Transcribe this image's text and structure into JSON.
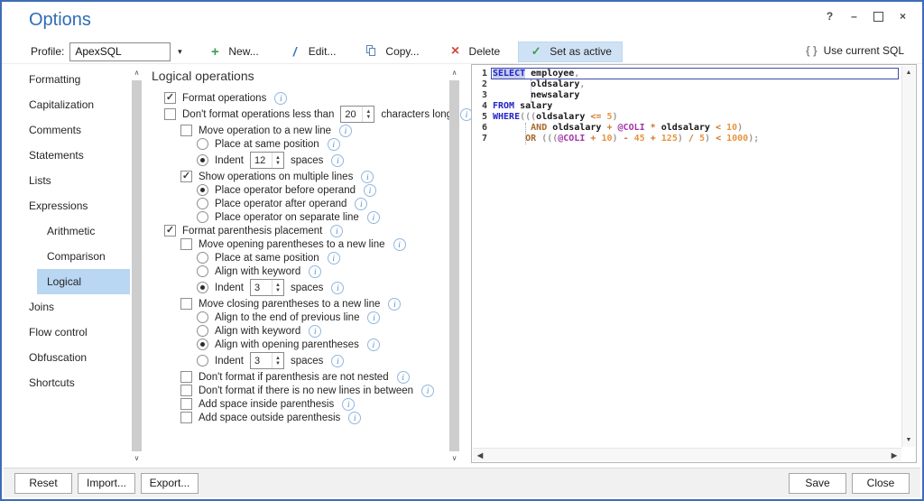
{
  "window": {
    "title": "Options",
    "controls": [
      {
        "name": "help-button",
        "glyph": "?"
      },
      {
        "name": "minimize-button",
        "glyph": "–"
      },
      {
        "name": "maximize-button",
        "glyph": ""
      },
      {
        "name": "close-button",
        "glyph": "×"
      }
    ]
  },
  "toolbar": {
    "profile_label": "Profile:",
    "profile_value": "ApexSQL",
    "dropdown_glyph": "▾",
    "buttons": [
      {
        "name": "new-button",
        "label": "New...",
        "icon": "plus-icon",
        "glyph": "+",
        "active": false
      },
      {
        "name": "edit-button",
        "label": "Edit...",
        "icon": "pencil-icon",
        "glyph": "/",
        "active": false
      },
      {
        "name": "copy-button",
        "label": "Copy...",
        "icon": "copy-icon",
        "glyph": "",
        "active": false
      },
      {
        "name": "delete-button",
        "label": "Delete",
        "icon": "delete-x-icon",
        "glyph": "×",
        "active": false
      },
      {
        "name": "set-as-active-button",
        "label": "Set as active",
        "icon": "check-icon",
        "glyph": "✓",
        "active": true
      }
    ],
    "braces": "{ }",
    "use_current_sql": "Use current SQL"
  },
  "sidebar": {
    "items": [
      {
        "label": "Formatting",
        "indent": 0,
        "selected": false
      },
      {
        "label": "Capitalization",
        "indent": 0,
        "selected": false
      },
      {
        "label": "Comments",
        "indent": 0,
        "selected": false
      },
      {
        "label": "Statements",
        "indent": 0,
        "selected": false
      },
      {
        "label": "Lists",
        "indent": 0,
        "selected": false
      },
      {
        "label": "Expressions",
        "indent": 0,
        "selected": false
      },
      {
        "label": "Arithmetic",
        "indent": 1,
        "selected": false
      },
      {
        "label": "Comparison",
        "indent": 1,
        "selected": false
      },
      {
        "label": "Logical",
        "indent": 1,
        "selected": true
      },
      {
        "label": "Joins",
        "indent": 0,
        "selected": false
      },
      {
        "label": "Flow control",
        "indent": 0,
        "selected": false
      },
      {
        "label": "Obfuscation",
        "indent": 0,
        "selected": false
      },
      {
        "label": "Shortcuts",
        "indent": 0,
        "selected": false
      }
    ]
  },
  "panel": {
    "title": "Logical operations",
    "rows": [
      {
        "type": "checkbox",
        "indent": 0,
        "checked": true,
        "label": "Format operations",
        "spinner": null,
        "suffix": "",
        "info": true
      },
      {
        "type": "checkbox",
        "indent": 0,
        "checked": false,
        "label": "Don't format operations less than",
        "spinner": "20",
        "suffix": "characters long",
        "info": true
      },
      {
        "type": "checkbox",
        "indent": 1,
        "checked": false,
        "label": "Move operation to a new line",
        "spinner": null,
        "suffix": "",
        "info": true
      },
      {
        "type": "radio",
        "indent": 2,
        "checked": false,
        "label": "Place at same position",
        "spinner": null,
        "suffix": "",
        "info": true
      },
      {
        "type": "radio",
        "indent": 2,
        "checked": true,
        "label": "Indent",
        "spinner": "12",
        "suffix": "spaces",
        "info": true
      },
      {
        "type": "checkbox",
        "indent": 1,
        "checked": true,
        "label": "Show operations on multiple lines",
        "spinner": null,
        "suffix": "",
        "info": true
      },
      {
        "type": "radio",
        "indent": 2,
        "checked": true,
        "label": "Place operator before operand",
        "spinner": null,
        "suffix": "",
        "info": true
      },
      {
        "type": "radio",
        "indent": 2,
        "checked": false,
        "label": "Place operator after operand",
        "spinner": null,
        "suffix": "",
        "info": true
      },
      {
        "type": "radio",
        "indent": 2,
        "checked": false,
        "label": "Place operator on separate line",
        "spinner": null,
        "suffix": "",
        "info": true
      },
      {
        "type": "checkbox",
        "indent": 0,
        "checked": true,
        "label": "Format parenthesis placement",
        "spinner": null,
        "suffix": "",
        "info": true
      },
      {
        "type": "checkbox",
        "indent": 1,
        "checked": false,
        "label": "Move opening parentheses to a new line",
        "spinner": null,
        "suffix": "",
        "info": true
      },
      {
        "type": "radio",
        "indent": 2,
        "checked": false,
        "label": "Place at same position",
        "spinner": null,
        "suffix": "",
        "info": true
      },
      {
        "type": "radio",
        "indent": 2,
        "checked": false,
        "label": "Align with keyword",
        "spinner": null,
        "suffix": "",
        "info": true
      },
      {
        "type": "radio",
        "indent": 2,
        "checked": true,
        "label": "Indent",
        "spinner": "3",
        "suffix": "spaces",
        "info": true
      },
      {
        "type": "checkbox",
        "indent": 1,
        "checked": false,
        "label": "Move closing parentheses to a new line",
        "spinner": null,
        "suffix": "",
        "info": true
      },
      {
        "type": "radio",
        "indent": 2,
        "checked": false,
        "label": "Align to the end of previous line",
        "spinner": null,
        "suffix": "",
        "info": true
      },
      {
        "type": "radio",
        "indent": 2,
        "checked": false,
        "label": "Align with keyword",
        "spinner": null,
        "suffix": "",
        "info": true
      },
      {
        "type": "radio",
        "indent": 2,
        "checked": true,
        "label": "Align with opening parentheses",
        "spinner": null,
        "suffix": "",
        "info": true
      },
      {
        "type": "radio",
        "indent": 2,
        "checked": false,
        "label": "Indent",
        "spinner": "3",
        "suffix": "spaces",
        "info": true
      },
      {
        "type": "checkbox",
        "indent": 1,
        "checked": false,
        "label": "Don't format if parenthesis are not nested",
        "spinner": null,
        "suffix": "",
        "info": true
      },
      {
        "type": "checkbox",
        "indent": 1,
        "checked": false,
        "label": "Don't format if there is no new lines in between",
        "spinner": null,
        "suffix": "",
        "info": true
      },
      {
        "type": "checkbox",
        "indent": 1,
        "checked": false,
        "label": "Add space inside parenthesis",
        "spinner": null,
        "suffix": "",
        "info": true
      },
      {
        "type": "checkbox",
        "indent": 1,
        "checked": false,
        "label": "Add space outside parenthesis",
        "spinner": null,
        "suffix": "",
        "info": true
      }
    ]
  },
  "editor": {
    "lines": [
      {
        "num": "1",
        "focused": true,
        "segs": [
          [
            "k sel",
            "SELECT"
          ],
          [
            "s",
            " "
          ],
          [
            "i",
            "employee"
          ],
          [
            "p",
            ","
          ]
        ]
      },
      {
        "num": "2",
        "focused": false,
        "segs": [
          [
            "s",
            "       "
          ],
          [
            "i",
            "oldsalary"
          ],
          [
            "p",
            ","
          ]
        ]
      },
      {
        "num": "3",
        "focused": false,
        "segs": [
          [
            "s",
            "       "
          ],
          [
            "i",
            "newsalary"
          ]
        ]
      },
      {
        "num": "4",
        "focused": false,
        "segs": [
          [
            "k",
            "FROM"
          ],
          [
            "s",
            " "
          ],
          [
            "i",
            "salary"
          ]
        ]
      },
      {
        "num": "5",
        "focused": false,
        "segs": [
          [
            "k",
            "WHERE"
          ],
          [
            "p",
            "((("
          ],
          [
            "i",
            "oldsalary"
          ],
          [
            "s",
            " "
          ],
          [
            "o",
            "<="
          ],
          [
            "s",
            " "
          ],
          [
            "n",
            "5"
          ],
          [
            "p",
            ")"
          ]
        ]
      },
      {
        "num": "6",
        "focused": false,
        "segs": [
          [
            "s",
            "       "
          ],
          [
            "l",
            "AND"
          ],
          [
            "s",
            " "
          ],
          [
            "i",
            "oldsalary"
          ],
          [
            "s",
            " "
          ],
          [
            "o",
            "+"
          ],
          [
            "s",
            " "
          ],
          [
            "v",
            "@COLI"
          ],
          [
            "s",
            " "
          ],
          [
            "o",
            "*"
          ],
          [
            "s",
            " "
          ],
          [
            "i",
            "oldsalary"
          ],
          [
            "s",
            " "
          ],
          [
            "o",
            "<"
          ],
          [
            "s",
            " "
          ],
          [
            "n",
            "10"
          ],
          [
            "p",
            ")"
          ]
        ]
      },
      {
        "num": "7",
        "focused": false,
        "segs": [
          [
            "s",
            "      "
          ],
          [
            "l",
            "OR"
          ],
          [
            "s",
            " "
          ],
          [
            "p",
            "((("
          ],
          [
            "v",
            "@COLI"
          ],
          [
            "s",
            " "
          ],
          [
            "o",
            "+"
          ],
          [
            "s",
            " "
          ],
          [
            "n",
            "10"
          ],
          [
            "p",
            ")"
          ],
          [
            "s",
            " "
          ],
          [
            "o",
            "-"
          ],
          [
            "s",
            " "
          ],
          [
            "n",
            "45"
          ],
          [
            "s",
            " "
          ],
          [
            "o",
            "+"
          ],
          [
            "s",
            " "
          ],
          [
            "n",
            "125"
          ],
          [
            "p",
            ")"
          ],
          [
            "s",
            " "
          ],
          [
            "o",
            "/"
          ],
          [
            "s",
            " "
          ],
          [
            "n",
            "5"
          ],
          [
            "p",
            ")"
          ],
          [
            "s",
            " "
          ],
          [
            "o",
            "<"
          ],
          [
            "s",
            " "
          ],
          [
            "n",
            "1000"
          ],
          [
            "p",
            ");"
          ]
        ]
      }
    ]
  },
  "footer": {
    "left": [
      {
        "name": "reset-button",
        "label": "Reset"
      },
      {
        "name": "import-button",
        "label": "Import..."
      },
      {
        "name": "export-button",
        "label": "Export..."
      }
    ],
    "right": [
      {
        "name": "save-button",
        "label": "Save"
      },
      {
        "name": "close-button",
        "label": "Close"
      }
    ]
  },
  "colors": {
    "dialog_border": "#3f6db5",
    "title_blue": "#2e6db5",
    "selected_sidebar_bg": "#b9d6f2",
    "set_active_bg": "#cfe2f5",
    "sql_keyword": "#2323c8",
    "sql_identifier": "#161616",
    "sql_operator": "#c8782b",
    "sql_logical_op": "#a8682c",
    "sql_number": "#e89540",
    "sql_variable": "#a433a8",
    "sql_paren": "#9a9a9a",
    "sql_selection_bg": "#c6cfec",
    "focus_line_border": "#3d49ae"
  }
}
